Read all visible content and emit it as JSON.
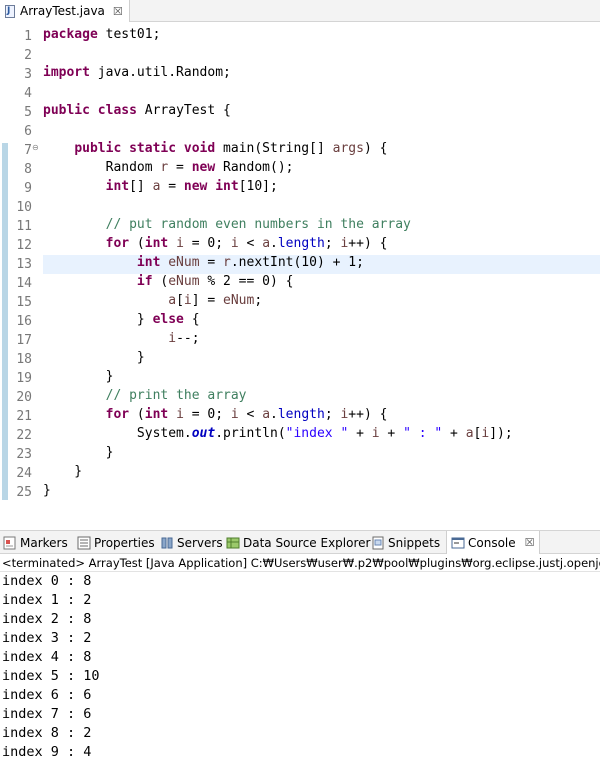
{
  "editor_tab": {
    "label": "ArrayTest.java",
    "close": "☒"
  },
  "code_lines": [
    {
      "n": "1",
      "html": "<span class=\"kw\">package</span> test01;"
    },
    {
      "n": "2",
      "html": ""
    },
    {
      "n": "3",
      "html": "<span class=\"kw\">import</span> java.util.Random;"
    },
    {
      "n": "4",
      "html": ""
    },
    {
      "n": "5",
      "html": "<span class=\"kw\">public</span> <span class=\"kw\">class</span> ArrayTest {"
    },
    {
      "n": "6",
      "html": ""
    },
    {
      "n": "7",
      "html": "    <span class=\"kw\">public</span> <span class=\"kw\">static</span> <span class=\"kw\">void</span> main(String[] <span class=\"var\">args</span>) {",
      "fold": "⊖"
    },
    {
      "n": "8",
      "html": "        Random <span class=\"var\">r</span> = <span class=\"kw\">new</span> Random();"
    },
    {
      "n": "9",
      "html": "        <span class=\"kw\">int</span>[] <span class=\"var\">a</span> = <span class=\"kw\">new</span> <span class=\"kw\">int</span>[10];"
    },
    {
      "n": "10",
      "html": ""
    },
    {
      "n": "11",
      "html": "        <span class=\"cm\">// put random even numbers in the array</span>"
    },
    {
      "n": "12",
      "html": "        <span class=\"kw\">for</span> (<span class=\"kw\">int</span> <span class=\"var\">i</span> = 0; <span class=\"var\">i</span> &lt; <span class=\"var\">a</span>.<span class=\"fld\">length</span>; <span class=\"var\">i</span>++) {"
    },
    {
      "n": "13",
      "html": "            <span class=\"kw\">int</span> <span class=\"var\">eNum</span> = <span class=\"var\">r</span>.nextInt(10) + 1;",
      "highlight": true
    },
    {
      "n": "14",
      "html": "            <span class=\"kw\">if</span> (<span class=\"var\">eNum</span> % 2 == 0) {"
    },
    {
      "n": "15",
      "html": "                <span class=\"var\">a</span>[<span class=\"var\">i</span>] = <span class=\"var\">eNum</span>;"
    },
    {
      "n": "16",
      "html": "            } <span class=\"kw\">else</span> {"
    },
    {
      "n": "17",
      "html": "                <span class=\"var\">i</span>--;"
    },
    {
      "n": "18",
      "html": "            }"
    },
    {
      "n": "19",
      "html": "        }"
    },
    {
      "n": "20",
      "html": "        <span class=\"cm\">// print the array</span>"
    },
    {
      "n": "21",
      "html": "        <span class=\"kw\">for</span> (<span class=\"kw\">int</span> <span class=\"var\">i</span> = 0; <span class=\"var\">i</span> &lt; <span class=\"var\">a</span>.<span class=\"fld\">length</span>; <span class=\"var\">i</span>++) {"
    },
    {
      "n": "22",
      "html": "            System.<span class=\"sfld\">out</span>.println(<span class=\"st\">\"index \"</span> + <span class=\"var\">i</span> + <span class=\"st\">\" : \"</span> + <span class=\"var\">a</span>[<span class=\"var\">i</span>]);"
    },
    {
      "n": "23",
      "html": "        }"
    },
    {
      "n": "24",
      "html": "    }"
    },
    {
      "n": "25",
      "html": "}"
    }
  ],
  "views_tabs": [
    {
      "label": "Markers",
      "icon": "markers-icon"
    },
    {
      "label": "Properties",
      "icon": "properties-icon"
    },
    {
      "label": "Servers",
      "icon": "servers-icon"
    },
    {
      "label": "Data Source Explorer",
      "icon": "data-source-explorer-icon"
    },
    {
      "label": "Snippets",
      "icon": "snippets-icon"
    },
    {
      "label": "Console",
      "icon": "console-icon",
      "active": true,
      "close": "☒"
    }
  ],
  "console": {
    "header": "<terminated> ArrayTest [Java Application] C:₩Users₩user₩.p2₩pool₩plugins₩org.eclipse.justj.openjdk.hotspot.",
    "output": [
      "index 0 : 8",
      "index 1 : 2",
      "index 2 : 8",
      "index 3 : 2",
      "index 4 : 8",
      "index 5 : 10",
      "index 6 : 6",
      "index 7 : 6",
      "index 8 : 2",
      "index 9 : 4"
    ]
  }
}
